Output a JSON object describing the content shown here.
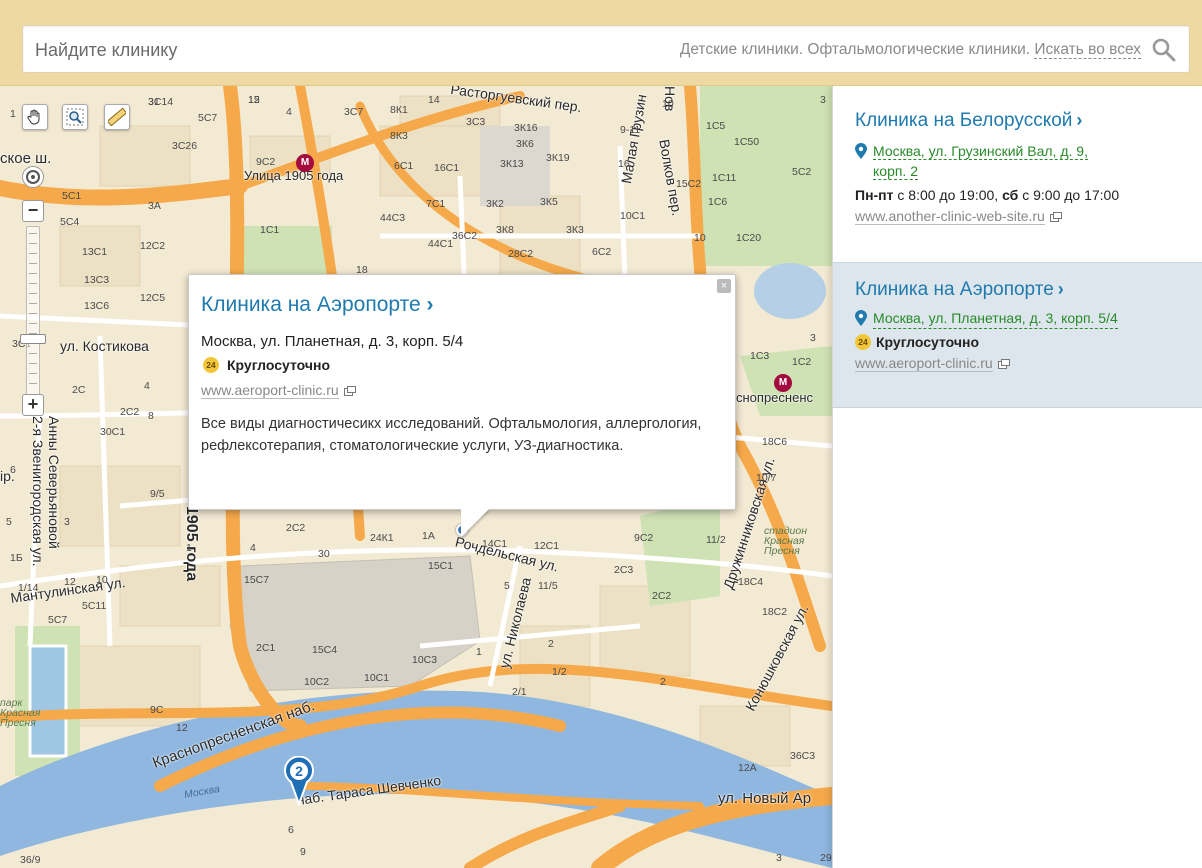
{
  "search": {
    "placeholder": "Найдите клинику",
    "suggest_1": "Детские клиники.",
    "suggest_2": "Офтальмологические клиники.",
    "suggest_all": "Искать во всех"
  },
  "map": {
    "streets": {
      "rastorguevsky": "Расторгуевский пер.",
      "ul_1905_metro": "Улица 1905 года",
      "kostikova": "ул. Костикова",
      "zvenigorodskaya": "2-я Звенигородская ул.",
      "anny_severyanovoy": "Анны Северьяновой",
      "rochdelskaya": "Рочдельская ул.",
      "nikolaeva": "ул. Николаева",
      "mantulinskaya": "Мантулинская ул.",
      "krasnopresnenskaya_nab": "Краснопресненская наб.",
      "tarasa_shevchenko": "наб. Тараса Шевченко",
      "moskva_river": "Москва",
      "novy_arbat": "ул. Новый Ар",
      "druzhinnikovskaya": "Дружинниковская ул.",
      "konyushkovskaya": "Конюшковская ул.",
      "malaya_gruzinskaya": "Малая Грузин",
      "volkov_per": "Волков пер.",
      "krasnopresnenskaya_metro": "снопресненс",
      "stadion": "стадион Красная Пресня",
      "park": "парк Красная Пресня",
      "goda_1905": "1905 года",
      "ul_trunc": "ул.",
      "sky_ul": "ская ул.",
      "skoe_sh": "ское ш.",
      "nov": "Нов",
      "ul_sev": "ул.",
      "ip": "ір."
    },
    "house_numbers": [
      "3С14",
      "15",
      "5С7",
      "4",
      "3С7",
      "8К1",
      "14",
      "3С3",
      "3К16",
      "10",
      "1С5",
      "3С26",
      "8К3",
      "3К6",
      "9-11",
      "1С50",
      "9С2",
      "6С1",
      "16С1",
      "3К13",
      "3К19",
      "16",
      "15С2",
      "5С2",
      "1С11",
      "5С1",
      "3А",
      "7С1",
      "3К2",
      "3К5",
      "1С6",
      "5С4",
      "1С1",
      "44С3",
      "36С2",
      "3К8",
      "3К3",
      "10С1",
      "10",
      "1С20",
      "13С1",
      "12С2",
      "44С1",
      "28С2",
      "6С2",
      "13С3",
      "12С5",
      "13С6",
      "3С1",
      "1С3",
      "1С2",
      "2С",
      "4",
      "2С2",
      "8",
      "30С1",
      "18С6",
      "10/7",
      "6",
      "9/5",
      "5",
      "3",
      "2С2",
      "24К1",
      "1А",
      "14С1",
      "12С1",
      "9С2",
      "11/2",
      "1Б",
      "4",
      "1",
      "30",
      "15С1",
      "2С3",
      "18С4",
      "1/14",
      "12",
      "10",
      "15С7",
      "5",
      "11/5",
      "2С2",
      "18С2",
      "5С11",
      "5С7",
      "2С1",
      "15С4",
      "10С3",
      "1",
      "1/2",
      "2",
      "10С2",
      "10С1",
      "2/1",
      "9С",
      "12",
      "12А",
      "36С3",
      "36/9",
      "3",
      "29",
      "6",
      "9",
      "2",
      "3",
      "1",
      "3",
      "18",
      "1С1",
      "31",
      "12"
    ],
    "cluster_count": "2",
    "metro_glyph": "М"
  },
  "balloon": {
    "title": "Клиника на Аэропорте",
    "title_chevron": "›",
    "address": "Москва, ул. Планетная, д. 3, корп. 5/4",
    "hours_badge": "24",
    "hours": "Круглосуточно",
    "site": "www.aeroport-clinic.ru",
    "description": "Все виды диагностичесикх исследований. Офтальмология, аллергология, рефлексотерапия, стоматологические услуги, УЗ-диагностика.",
    "close": "×"
  },
  "sidebar": {
    "items": [
      {
        "title": "Клиника на Белорусской",
        "chevron": "›",
        "address_line1": "Москва, ул. Грузинский Вал, д. 9,",
        "address_line2": "корп. 2",
        "hours_label_1": "Пн-пт",
        "hours_text_1": " с 8:00 до 19:00, ",
        "hours_label_2": "сб",
        "hours_text_2": " с 9:00 до 17:00",
        "site": "www.another-clinic-web-site.ru"
      },
      {
        "title": "Клиника на Аэропорте",
        "chevron": "›",
        "address": "Москва, ул. Планетная, д. 3, корп. 5/4",
        "hours_badge": "24",
        "hours": "Круглосуточно",
        "site": "www.aeroport-clinic.ru"
      }
    ]
  },
  "colors": {
    "accent_link": "#1f7aae",
    "address_green": "#2a8a2a",
    "search_bar_bg": "#efd9a2",
    "active_card_bg": "#dde6ec",
    "road_orange": "#f6a94a",
    "river_blue": "#8fb7df",
    "metro_red": "#a30b3e"
  },
  "icons": [
    "search-icon",
    "hand-icon",
    "zoom-region-icon",
    "ruler-icon",
    "locate-icon",
    "zoom-in-icon",
    "zoom-out-icon",
    "close-icon",
    "pin-icon",
    "external-link-icon",
    "metro-icon",
    "cluster-marker-icon"
  ]
}
